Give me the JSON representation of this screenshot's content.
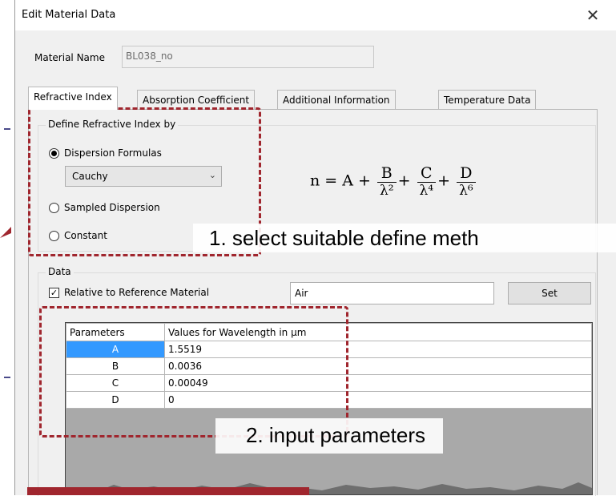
{
  "dialog": {
    "title": "Edit Material Data",
    "close_glyph": "✕"
  },
  "material": {
    "name_label": "Material Name",
    "name_value": "BL038_no"
  },
  "tabs": [
    {
      "label": "Refractive Index",
      "active": true
    },
    {
      "label": "Absorption Coefficient",
      "active": false
    },
    {
      "label": "Additional Information",
      "active": false
    },
    {
      "label": "Temperature Data",
      "active": false
    }
  ],
  "define_group": {
    "title": "Define Refractive Index by",
    "options": [
      {
        "label": "Dispersion Formulas",
        "selected": true
      },
      {
        "label": "Sampled Dispersion",
        "selected": false
      },
      {
        "label": "Constant",
        "selected": false
      }
    ],
    "formula_select": "Cauchy"
  },
  "formula": {
    "lhs": "n = A +",
    "terms": [
      {
        "num": "B",
        "den": "λ²"
      },
      {
        "num": "C",
        "den": "λ⁴"
      },
      {
        "num": "D",
        "den": "λ⁶"
      }
    ],
    "plus": "+"
  },
  "data_group": {
    "title": "Data",
    "relative_label": "Relative to Reference Material",
    "relative_checked": true,
    "reference_material": "Air",
    "set_label": "Set"
  },
  "params_table": {
    "headers": [
      "Parameters",
      "Values for Wavelength in µm"
    ],
    "rows": [
      {
        "param": "A",
        "value": "1.5519",
        "selected": true
      },
      {
        "param": "B",
        "value": "0.0036",
        "selected": false
      },
      {
        "param": "C",
        "value": "0.00049",
        "selected": false
      },
      {
        "param": "D",
        "value": "0",
        "selected": false
      }
    ]
  },
  "annotations": {
    "step1": "1.     select suitable define meth",
    "step2": "2.     input parameters",
    "accent_color": "#a0262e"
  },
  "colors": {
    "selection": "#3399ff",
    "dialog_bg": "#f0f0f0"
  }
}
